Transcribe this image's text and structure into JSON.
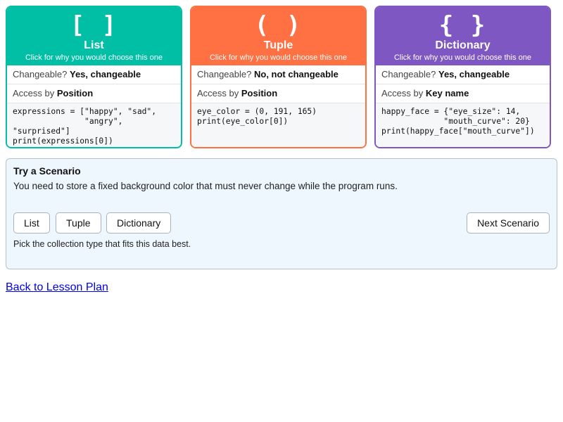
{
  "cards": [
    {
      "symbol": "[ ]",
      "title": "List",
      "subtitle": "Click for why you would choose this one",
      "accent": "#00bfa5",
      "changeable_label": "Changeable?",
      "changeable_value": "Yes, changeable",
      "access_label": "Access by",
      "access_value": "Position",
      "code": "expressions = [\"happy\", \"sad\",\n               \"angry\",\n\"surprised\"]\nprint(expressions[0])"
    },
    {
      "symbol": "( )",
      "title": "Tuple",
      "subtitle": "Click for why you would choose this one",
      "accent": "#ff7043",
      "changeable_label": "Changeable?",
      "changeable_value": "No, not changeable",
      "access_label": "Access by",
      "access_value": "Position",
      "code": "eye_color = (0, 191, 165)\nprint(eye_color[0])"
    },
    {
      "symbol": "{ }",
      "title": "Dictionary",
      "subtitle": "Click for why you would choose this one",
      "accent": "#7e57c2",
      "changeable_label": "Changeable?",
      "changeable_value": "Yes, changeable",
      "access_label": "Access by",
      "access_value": "Key name",
      "code": "happy_face = {\"eye_size\": 14,\n             \"mouth_curve\": 20}\nprint(happy_face[\"mouth_curve\"])"
    }
  ],
  "scenario": {
    "title": "Try a Scenario",
    "text": "You need to store a fixed background color that must never change while the program runs.",
    "choices": [
      "List",
      "Tuple",
      "Dictionary"
    ],
    "next_label": "Next Scenario",
    "hint": "Pick the collection type that fits this data best.",
    "background": "#eef6fe"
  },
  "back_link": "Back to Lesson Plan"
}
